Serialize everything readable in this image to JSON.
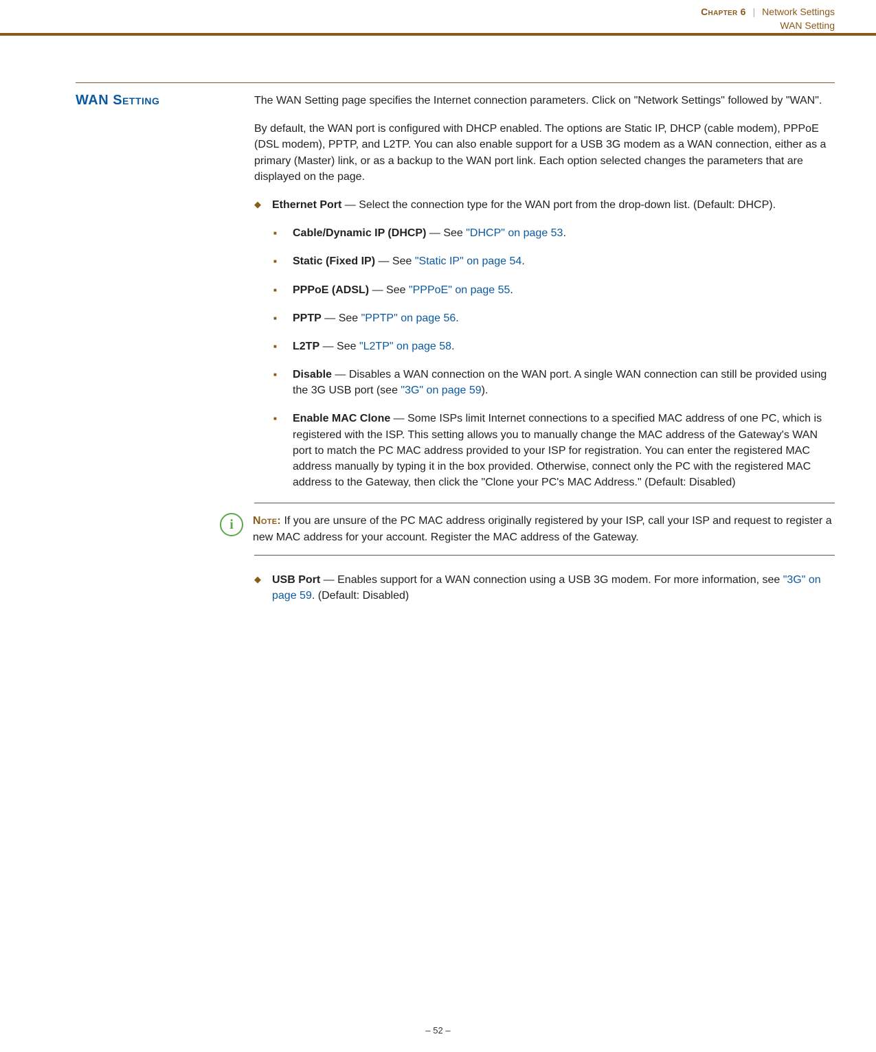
{
  "header": {
    "chapter_label": "Chapter 6",
    "separator": "|",
    "breadcrumb": "Network Settings",
    "sub": "WAN Setting"
  },
  "section": {
    "title_lead": "WAN S",
    "title_rest": "etting"
  },
  "intro": {
    "p1": "The WAN Setting page specifies the Internet connection parameters. Click on \"Network Settings\" followed by \"WAN\".",
    "p2": "By default, the WAN port is configured with DHCP enabled. The options are Static IP, DHCP (cable modem), PPPoE (DSL modem), PPTP, and L2TP. You can also enable support for a USB 3G modem as a WAN connection, either as a primary (Master) link, or as a backup to the WAN port link. Each option selected changes the parameters that are displayed on the page."
  },
  "ethernet": {
    "label": "Ethernet Port",
    "desc": " — Select the connection type for the WAN port from the drop-down list. (Default: DHCP).",
    "items": {
      "dhcp_label": "Cable/Dynamic IP (DHCP)",
      "dhcp_see": " — See ",
      "dhcp_link": "\"DHCP\" on page 53",
      "dhcp_end": ".",
      "static_label": "Static (Fixed IP)",
      "static_see": " — See ",
      "static_link": "\"Static IP\" on page 54",
      "static_end": ".",
      "pppoe_label": "PPPoE (ADSL)",
      "pppoe_see": " — See ",
      "pppoe_link": "\"PPPoE\" on page 55",
      "pppoe_end": ".",
      "pptp_label": "PPTP",
      "pptp_see": " — See ",
      "pptp_link": "\"PPTP\" on page 56",
      "pptp_end": ".",
      "l2tp_label": "L2TP",
      "l2tp_see": " — See ",
      "l2tp_link": "\"L2TP\" on page 58",
      "l2tp_end": ".",
      "disable_label": "Disable",
      "disable_desc_1": " — Disables a WAN connection on the WAN port. A single WAN connection can still be provided using the 3G USB port (see ",
      "disable_link": "\"3G\" on page 59",
      "disable_desc_2": ").",
      "mac_label": "Enable MAC Clone",
      "mac_desc": " — Some ISPs limit Internet connections to a specified MAC address of one PC, which is registered with the ISP. This setting allows you to manually change the MAC address of the Gateway's WAN port to match the PC MAC address provided to your ISP for registration. You can enter the registered MAC address manually by typing it in the box provided. Otherwise, connect only the PC with the registered MAC address to the Gateway, then click the \"Clone your PC's MAC Address.\" (Default: Disabled)"
    }
  },
  "note": {
    "icon_glyph": "i",
    "label": "Note:",
    "text": " If you are unsure of the PC MAC address originally registered by your ISP, call your ISP and request to register a new MAC address for your account. Register the MAC address of the Gateway."
  },
  "usb": {
    "label": "USB Port",
    "desc_1": " — Enables support for a WAN connection using a USB 3G modem. For more information, see ",
    "link": "\"3G\" on page 59",
    "desc_2": ". (Default: Disabled)"
  },
  "footer": {
    "page": "–  52  –"
  }
}
